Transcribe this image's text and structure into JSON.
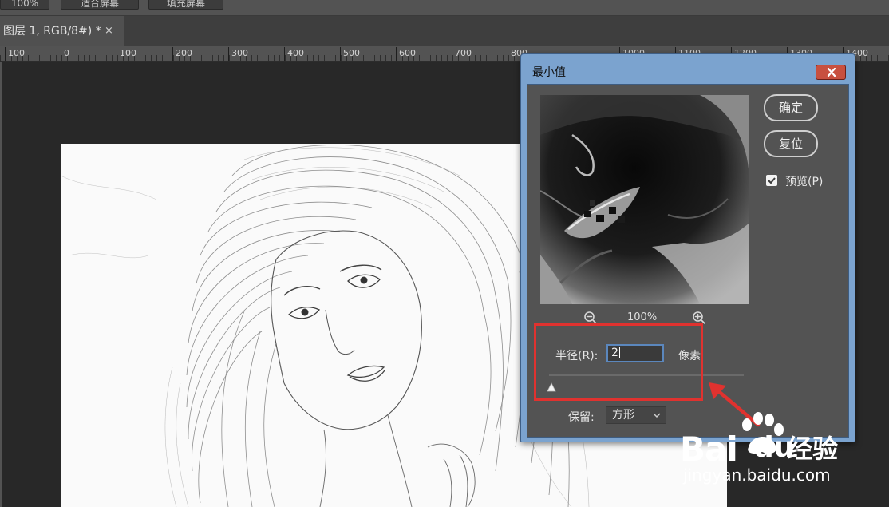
{
  "topbar": {
    "zoom_value": "100%",
    "fit_screen_label": "适合屏幕",
    "fill_screen_label": "填充屏幕"
  },
  "document_tab": {
    "title": "图层 1, RGB/8#) *",
    "close_glyph": "×"
  },
  "ruler": {
    "labels": [
      "100",
      "0",
      "100",
      "200",
      "300",
      "400",
      "500",
      "600",
      "700",
      "800",
      "1000",
      "1100",
      "1200",
      "1300",
      "1400"
    ]
  },
  "dialog": {
    "title": "最小值",
    "ok_label": "确定",
    "reset_label": "复位",
    "preview_label": "预览(P)",
    "preview_checked": true,
    "zoom_percent": "100%",
    "radius_label": "半径(R):",
    "radius_value": "2",
    "unit_label": "像素",
    "slider_level": 0.0,
    "preserve_label": "保留:",
    "preserve_value": "方形"
  },
  "watermark": {
    "brand_latin": "Bai",
    "brand_du": "du",
    "brand_cn": "经验",
    "url": "jingyan.baidu.com"
  },
  "colors": {
    "annotation_red": "#e0322f",
    "dialog_frame": "#7ba3cf",
    "panel": "#535353"
  },
  "icons": [
    "close-icon",
    "zoom-out-icon",
    "zoom-in-icon",
    "checkmark-icon",
    "chevron-down-icon",
    "slider-thumb-icon",
    "annotation-arrow",
    "baidu-paw-logo"
  ]
}
